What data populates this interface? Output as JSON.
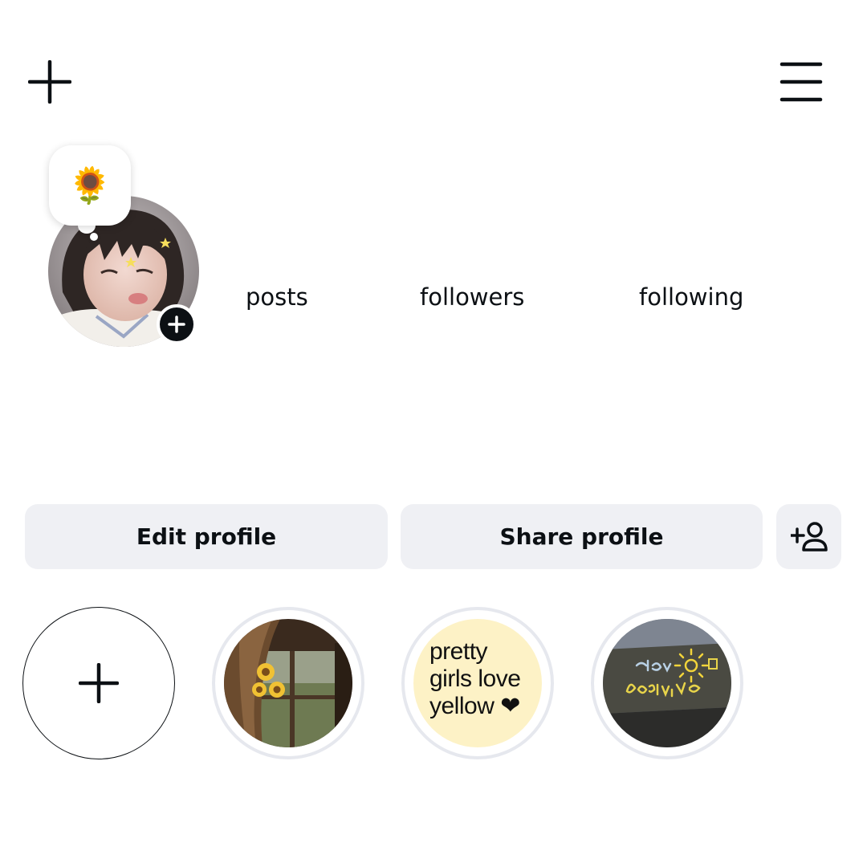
{
  "toolbar": {
    "new_post_icon": "plus-icon",
    "menu_icon": "hamburger-menu-icon"
  },
  "note": {
    "emoji": "🌻"
  },
  "profile": {
    "avatar_add_icon": "plus-icon"
  },
  "stats": {
    "posts_label": "posts",
    "followers_label": "followers",
    "following_label": "following"
  },
  "actions": {
    "edit_label": "Edit profile",
    "share_label": "Share profile",
    "discover_icon": "add-person-icon"
  },
  "highlights": {
    "new_icon": "plus-icon",
    "items": [
      {
        "image": "sunflowers-window"
      },
      {
        "image": "yellow-text-card",
        "text_lines": [
          "pretty",
          "girls love",
          "yellow ❤"
        ]
      },
      {
        "image": "stay-positive-chalk"
      }
    ]
  },
  "colors": {
    "text": "#0c1014",
    "button_bg": "#eff0f4",
    "ring": "#e6e8ee",
    "yellow_card": "#fdf2c6",
    "accent_yellow": "#f2d43a"
  }
}
